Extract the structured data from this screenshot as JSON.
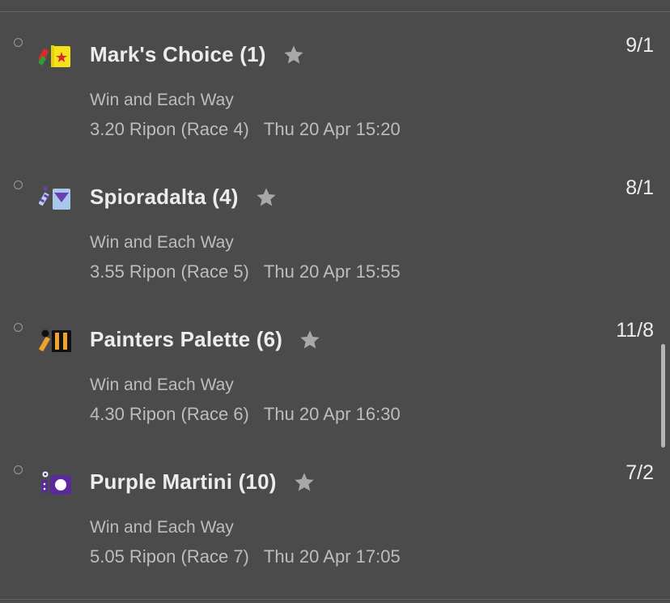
{
  "selections": [
    {
      "name": "Mark's Choice (1)",
      "bet_type": "Win and Each Way",
      "race": "3.20 Ripon (Race 4)",
      "datetime": "Thu 20 Apr 15:20",
      "odds": "9/1",
      "silks": "silks-yellow-red-star-icon"
    },
    {
      "name": "Spioradalta (4)",
      "bet_type": "Win and Each Way",
      "race": "3.55 Ripon (Race 5)",
      "datetime": "Thu 20 Apr 15:55",
      "odds": "8/1",
      "silks": "silks-lightblue-purple-chevron-icon"
    },
    {
      "name": "Painters Palette (6)",
      "bet_type": "Win and Each Way",
      "race": "4.30 Ripon (Race 6)",
      "datetime": "Thu 20 Apr 16:30",
      "odds": "11/8",
      "silks": "silks-orange-black-stripes-icon"
    },
    {
      "name": "Purple Martini (10)",
      "bet_type": "Win and Each Way",
      "race": "5.05 Ripon (Race 7)",
      "datetime": "Thu 20 Apr 17:05",
      "odds": "7/2",
      "silks": "silks-purple-white-spot-icon"
    }
  ],
  "colors": {
    "background": "#4b4b4b",
    "primary_text": "#ececec",
    "secondary_text": "#bdbdbd",
    "star": "#a8a8a8"
  }
}
